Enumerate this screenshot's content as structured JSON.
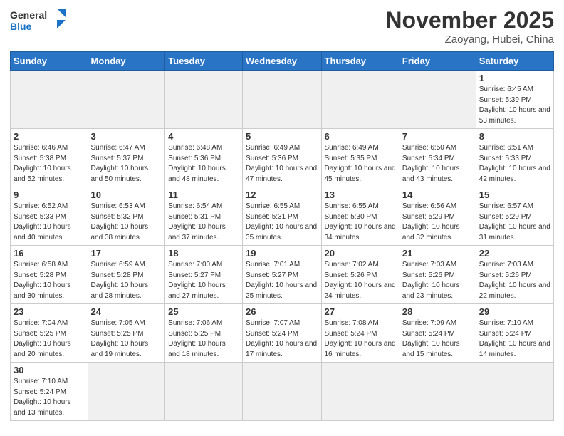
{
  "header": {
    "logo_general": "General",
    "logo_blue": "Blue",
    "month_title": "November 2025",
    "location": "Zaoyang, Hubei, China"
  },
  "days_of_week": [
    "Sunday",
    "Monday",
    "Tuesday",
    "Wednesday",
    "Thursday",
    "Friday",
    "Saturday"
  ],
  "weeks": [
    [
      {
        "day": "",
        "info": ""
      },
      {
        "day": "",
        "info": ""
      },
      {
        "day": "",
        "info": ""
      },
      {
        "day": "",
        "info": ""
      },
      {
        "day": "",
        "info": ""
      },
      {
        "day": "",
        "info": ""
      },
      {
        "day": "1",
        "info": "Sunrise: 6:45 AM\nSunset: 5:39 PM\nDaylight: 10 hours and 53 minutes."
      }
    ],
    [
      {
        "day": "2",
        "info": "Sunrise: 6:46 AM\nSunset: 5:38 PM\nDaylight: 10 hours and 52 minutes."
      },
      {
        "day": "3",
        "info": "Sunrise: 6:47 AM\nSunset: 5:37 PM\nDaylight: 10 hours and 50 minutes."
      },
      {
        "day": "4",
        "info": "Sunrise: 6:48 AM\nSunset: 5:36 PM\nDaylight: 10 hours and 48 minutes."
      },
      {
        "day": "5",
        "info": "Sunrise: 6:49 AM\nSunset: 5:36 PM\nDaylight: 10 hours and 47 minutes."
      },
      {
        "day": "6",
        "info": "Sunrise: 6:49 AM\nSunset: 5:35 PM\nDaylight: 10 hours and 45 minutes."
      },
      {
        "day": "7",
        "info": "Sunrise: 6:50 AM\nSunset: 5:34 PM\nDaylight: 10 hours and 43 minutes."
      },
      {
        "day": "8",
        "info": "Sunrise: 6:51 AM\nSunset: 5:33 PM\nDaylight: 10 hours and 42 minutes."
      }
    ],
    [
      {
        "day": "9",
        "info": "Sunrise: 6:52 AM\nSunset: 5:33 PM\nDaylight: 10 hours and 40 minutes."
      },
      {
        "day": "10",
        "info": "Sunrise: 6:53 AM\nSunset: 5:32 PM\nDaylight: 10 hours and 38 minutes."
      },
      {
        "day": "11",
        "info": "Sunrise: 6:54 AM\nSunset: 5:31 PM\nDaylight: 10 hours and 37 minutes."
      },
      {
        "day": "12",
        "info": "Sunrise: 6:55 AM\nSunset: 5:31 PM\nDaylight: 10 hours and 35 minutes."
      },
      {
        "day": "13",
        "info": "Sunrise: 6:55 AM\nSunset: 5:30 PM\nDaylight: 10 hours and 34 minutes."
      },
      {
        "day": "14",
        "info": "Sunrise: 6:56 AM\nSunset: 5:29 PM\nDaylight: 10 hours and 32 minutes."
      },
      {
        "day": "15",
        "info": "Sunrise: 6:57 AM\nSunset: 5:29 PM\nDaylight: 10 hours and 31 minutes."
      }
    ],
    [
      {
        "day": "16",
        "info": "Sunrise: 6:58 AM\nSunset: 5:28 PM\nDaylight: 10 hours and 30 minutes."
      },
      {
        "day": "17",
        "info": "Sunrise: 6:59 AM\nSunset: 5:28 PM\nDaylight: 10 hours and 28 minutes."
      },
      {
        "day": "18",
        "info": "Sunrise: 7:00 AM\nSunset: 5:27 PM\nDaylight: 10 hours and 27 minutes."
      },
      {
        "day": "19",
        "info": "Sunrise: 7:01 AM\nSunset: 5:27 PM\nDaylight: 10 hours and 25 minutes."
      },
      {
        "day": "20",
        "info": "Sunrise: 7:02 AM\nSunset: 5:26 PM\nDaylight: 10 hours and 24 minutes."
      },
      {
        "day": "21",
        "info": "Sunrise: 7:03 AM\nSunset: 5:26 PM\nDaylight: 10 hours and 23 minutes."
      },
      {
        "day": "22",
        "info": "Sunrise: 7:03 AM\nSunset: 5:26 PM\nDaylight: 10 hours and 22 minutes."
      }
    ],
    [
      {
        "day": "23",
        "info": "Sunrise: 7:04 AM\nSunset: 5:25 PM\nDaylight: 10 hours and 20 minutes."
      },
      {
        "day": "24",
        "info": "Sunrise: 7:05 AM\nSunset: 5:25 PM\nDaylight: 10 hours and 19 minutes."
      },
      {
        "day": "25",
        "info": "Sunrise: 7:06 AM\nSunset: 5:25 PM\nDaylight: 10 hours and 18 minutes."
      },
      {
        "day": "26",
        "info": "Sunrise: 7:07 AM\nSunset: 5:24 PM\nDaylight: 10 hours and 17 minutes."
      },
      {
        "day": "27",
        "info": "Sunrise: 7:08 AM\nSunset: 5:24 PM\nDaylight: 10 hours and 16 minutes."
      },
      {
        "day": "28",
        "info": "Sunrise: 7:09 AM\nSunset: 5:24 PM\nDaylight: 10 hours and 15 minutes."
      },
      {
        "day": "29",
        "info": "Sunrise: 7:10 AM\nSunset: 5:24 PM\nDaylight: 10 hours and 14 minutes."
      }
    ],
    [
      {
        "day": "30",
        "info": "Sunrise: 7:10 AM\nSunset: 5:24 PM\nDaylight: 10 hours and 13 minutes."
      },
      {
        "day": "",
        "info": ""
      },
      {
        "day": "",
        "info": ""
      },
      {
        "day": "",
        "info": ""
      },
      {
        "day": "",
        "info": ""
      },
      {
        "day": "",
        "info": ""
      },
      {
        "day": "",
        "info": ""
      }
    ]
  ]
}
